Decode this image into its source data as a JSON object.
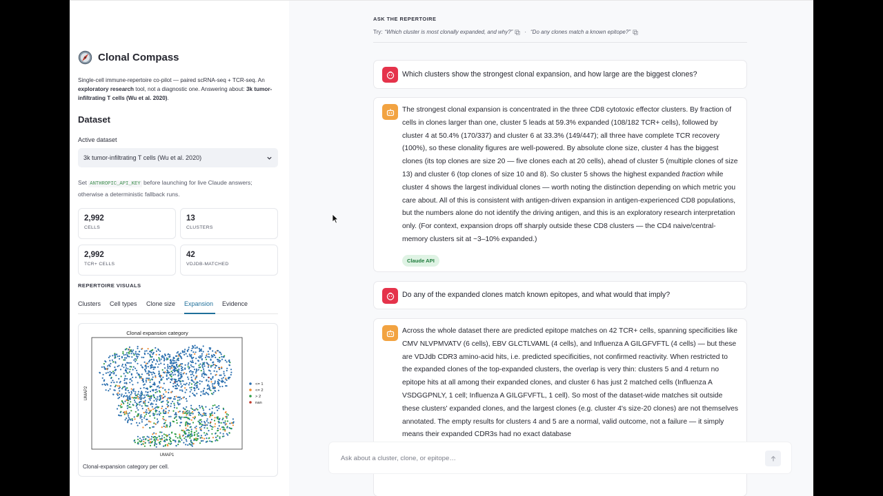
{
  "app": {
    "title": "Clonal Compass",
    "intro_a": "Single-cell immune-repertoire co-pilot — paired scRNA-seq + TCR-seq. An ",
    "intro_b": "exploratory research",
    "intro_c": " tool, not a diagnostic one. Answering about: ",
    "intro_d": "3k tumor-infiltrating T cells (Wu et al. 2020)",
    "intro_e": "."
  },
  "dataset": {
    "heading": "Dataset",
    "active_label": "Active dataset",
    "selected": "3k tumor-infiltrating T cells (Wu et al. 2020)",
    "key_pre": "Set ",
    "key_code": "ANTHROPIC_API_KEY",
    "key_post": " before launching for live Claude answers; otherwise a deterministic fallback runs."
  },
  "metrics": [
    {
      "value": "2,992",
      "label": "CELLS"
    },
    {
      "value": "13",
      "label": "CLUSTERS"
    },
    {
      "value": "2,992",
      "label": "TCR+ CELLS"
    },
    {
      "value": "42",
      "label": "VDJDB-MATCHED"
    }
  ],
  "visuals": {
    "heading": "REPERTOIRE VISUALS",
    "tabs": [
      "Clusters",
      "Cell types",
      "Clone size",
      "Expansion",
      "Evidence"
    ],
    "active_tab": "Expansion",
    "plot_title": "Clonal expansion category",
    "xlabel": "UMAP1",
    "ylabel": "UMAP2",
    "legend": [
      {
        "label": "<= 1",
        "color": "#2b6fae"
      },
      {
        "label": "<= 2",
        "color": "#f18a2e"
      },
      {
        "label": "> 2",
        "color": "#2f9e44"
      },
      {
        "label": "nan",
        "color": "#c0392b"
      }
    ],
    "caption": "Clonal-expansion category per cell."
  },
  "ask": {
    "heading": "ASK THE REPERTOIRE",
    "try_prefix": "Try:",
    "suggestion_1": "“Which cluster is most clonally expanded, and why?”",
    "separator": "·",
    "suggestion_2": "“Do any clones match a known epitope?”"
  },
  "messages": [
    {
      "role": "user",
      "text": "Which clusters show the strongest clonal expansion, and how large are the biggest clones?"
    },
    {
      "role": "assistant",
      "text_a": "The strongest clonal expansion is concentrated in the three CD8 cytotoxic effector clusters. By fraction of cells in clones larger than one, cluster 5 leads at 59.3% expanded (108/182 TCR+ cells), followed by cluster 4 at 50.4% (170/337) and cluster 6 at 33.3% (149/447); all three have complete TCR recovery (100%), so these clonality figures are well-powered. By absolute clone size, cluster 4 has the biggest clones (its top clones are size 20 — five clones each at 20 cells), ahead of cluster 5 (multiple clones of size 13) and cluster 6 (top clones of size 10 and 8). So cluster 5 shows the highest expanded ",
      "text_em": "fraction",
      "text_b": " while cluster 4 shows the largest individual clones — worth noting the distinction depending on which metric you care about. All of this is consistent with antigen-driven expansion in antigen-experienced CD8 populations, but the numbers alone do not identify the driving antigen, and this is an exploratory research interpretation only. (For context, expansion drops off sharply outside these CD8 clusters — the CD4 naive/central-memory clusters sit at ~3–10% expanded.)",
      "badge": "Claude API"
    },
    {
      "role": "user",
      "text": "Do any of the expanded clones match known epitopes, and what would that imply?"
    },
    {
      "role": "assistant",
      "text": "Across the whole dataset there are predicted epitope matches on 42 TCR+ cells, spanning specificities like CMV NLVPMVATV (6 cells), EBV GLCTLVAML (4 cells), and Influenza A GILGFVFTL (4 cells) — but these are VDJdb CDR3 amino-acid hits, i.e. predicted specificities, not confirmed reactivity. When restricted to the expanded clones of the top-expanded clusters, the overlap is very thin: clusters 5 and 4 return no epitope hits at all among their expanded clones, and cluster 6 has just 2 matched cells (Influenza A VSDGGPNLY, 1 cell; Influenza A GILGFVFTL, 1 cell). So most of the dataset-wide matches sit outside these clusters' expanded clones, and the largest clones (e.g. cluster 4's size-20 clones) are not themselves annotated. The empty results for clusters 4 and 5 are a normal, valid outcome, not a failure — it simply means their expanded CDR3s had no exact database"
    }
  ],
  "composer": {
    "placeholder": "Ask about a cluster, clone, or epitope…"
  }
}
